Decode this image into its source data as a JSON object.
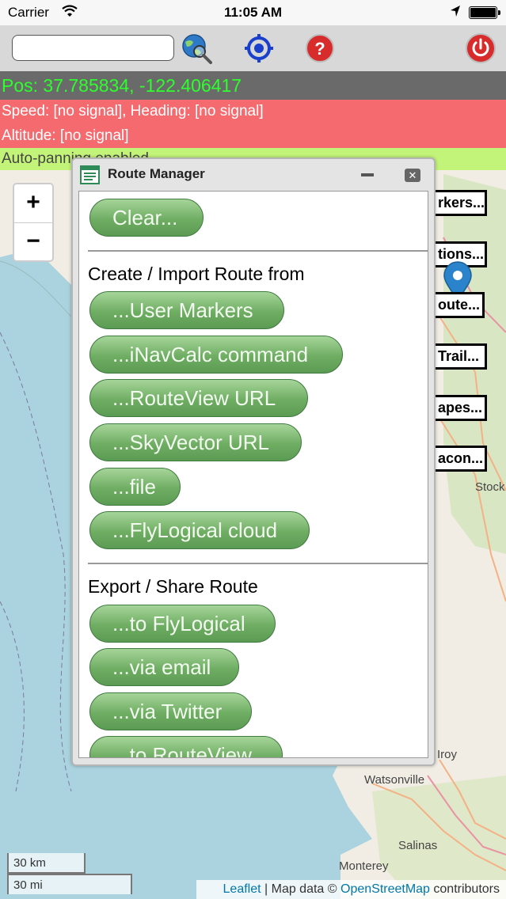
{
  "status_bar": {
    "carrier": "Carrier",
    "time": "11:05 AM"
  },
  "toolbar": {
    "search_value": "",
    "search_placeholder": ""
  },
  "info": {
    "position": "Pos: 37.785834, -122.406417",
    "speed": "Speed: [no signal], Heading: [no signal]",
    "altitude": "Altitude: [no signal]",
    "autopan": "Auto-panning enabled"
  },
  "zoom": {
    "in": "+",
    "out": "−"
  },
  "side_buttons": [
    "rkers...",
    "tions...",
    "oute...",
    "Trail...",
    "apes...",
    "acon..."
  ],
  "map_labels": {
    "stock": "Stock",
    "roy": "Iroy",
    "watsonville": "Watsonville",
    "salinas": "Salinas",
    "monterey": "Monterey"
  },
  "scale": {
    "km": "30 km",
    "mi": "30 mi"
  },
  "attribution": {
    "leaflet": "Leaflet",
    "sep": " | Map data © ",
    "osm": "OpenStreetMap",
    "contrib": " contributors"
  },
  "dialog": {
    "title": "Route Manager",
    "clear": "Clear...",
    "create_heading": "Create / Import Route from",
    "create_buttons": [
      "...User Markers",
      "...iNavCalc command",
      "...RouteView URL",
      "...SkyVector URL",
      "...file",
      "...FlyLogical cloud"
    ],
    "export_heading": "Export / Share Route",
    "export_buttons": [
      "...to FlyLogical",
      "...via email",
      "...via Twitter",
      "...to RouteView"
    ]
  },
  "colors": {
    "pos_text": "#2cff2c",
    "alert_bar": "#f46a6e",
    "autopan_bar": "#c3f47a",
    "button_green": "#6fad63"
  }
}
